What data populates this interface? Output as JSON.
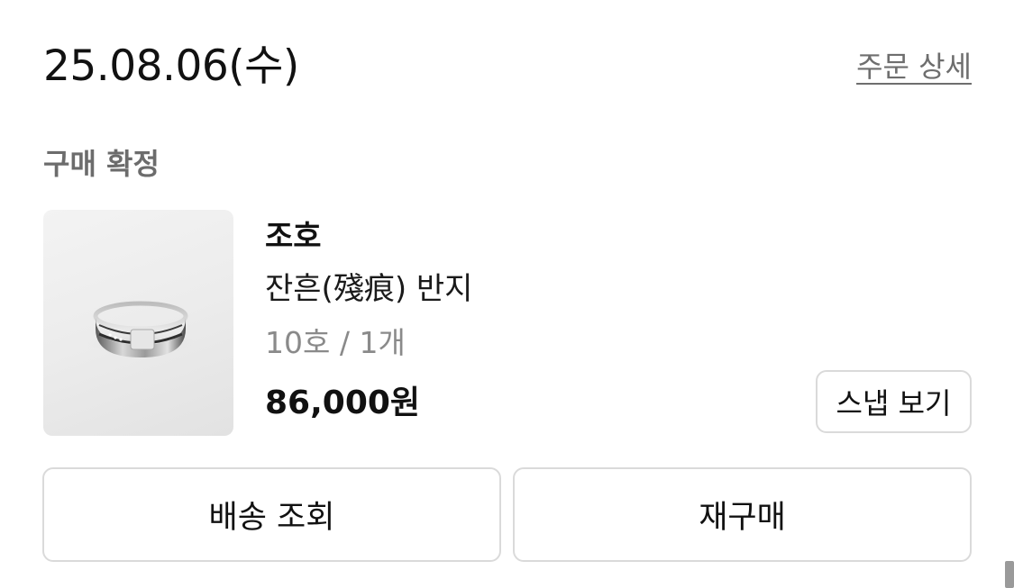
{
  "order": {
    "date": "25.08.06(수)",
    "detail_link": "주문 상세",
    "status": "구매 확정"
  },
  "product": {
    "brand": "조호",
    "name": "잔흔(殘痕) 반지",
    "option": "10호 / 1개",
    "price": "86,000원",
    "image_icon": "ring-product-photo"
  },
  "buttons": {
    "snap": "스냅 보기",
    "track_delivery": "배송 조회",
    "rebuy": "재구매"
  }
}
